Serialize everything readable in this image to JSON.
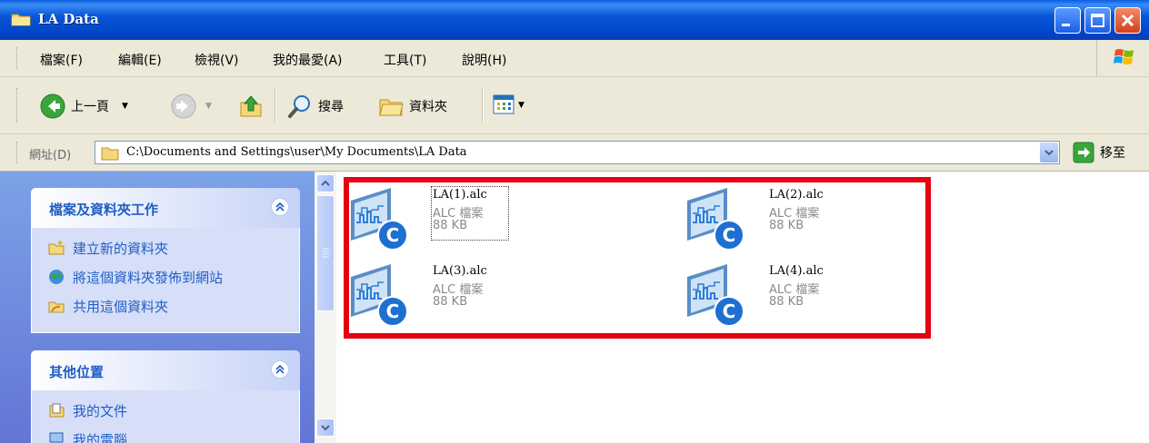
{
  "window": {
    "title": "LA Data"
  },
  "menu": {
    "items": [
      {
        "label": "檔案(F)"
      },
      {
        "label": "編輯(E)"
      },
      {
        "label": "檢視(V)"
      },
      {
        "label": "我的最愛(A)"
      },
      {
        "label": "工具(T)"
      },
      {
        "label": "說明(H)"
      }
    ]
  },
  "toolbar": {
    "back_label": "上一頁",
    "search_label": "搜尋",
    "folders_label": "資料夾"
  },
  "address": {
    "label": "網址(D)",
    "path": "C:\\Documents and Settings\\user\\My Documents\\LA Data",
    "go_label": "移至"
  },
  "tasks_panel": {
    "title": "檔案及資料夾工作",
    "items": [
      {
        "label": "建立新的資料夾",
        "icon": "new-folder-icon"
      },
      {
        "label": "將這個資料夾發佈到網站",
        "icon": "publish-web-icon"
      },
      {
        "label": "共用這個資料夾",
        "icon": "share-folder-icon"
      }
    ]
  },
  "places_panel": {
    "title": "其他位置",
    "items": [
      {
        "label": "我的文件",
        "icon": "my-documents-icon"
      },
      {
        "label": "我的電腦",
        "icon": "my-computer-icon"
      }
    ]
  },
  "files": [
    {
      "name": "LA(1).alc",
      "type": "ALC 檔案",
      "size": "88 KB",
      "selected": true
    },
    {
      "name": "LA(2).alc",
      "type": "ALC 檔案",
      "size": "88 KB"
    },
    {
      "name": "LA(3).alc",
      "type": "ALC 檔案",
      "size": "88 KB"
    },
    {
      "name": "LA(4).alc",
      "type": "ALC 檔案",
      "size": "88 KB"
    }
  ],
  "colors": {
    "titlebar": "#0a56d8",
    "highlight_box": "#e60012",
    "taskpane_link": "#215dc6"
  }
}
